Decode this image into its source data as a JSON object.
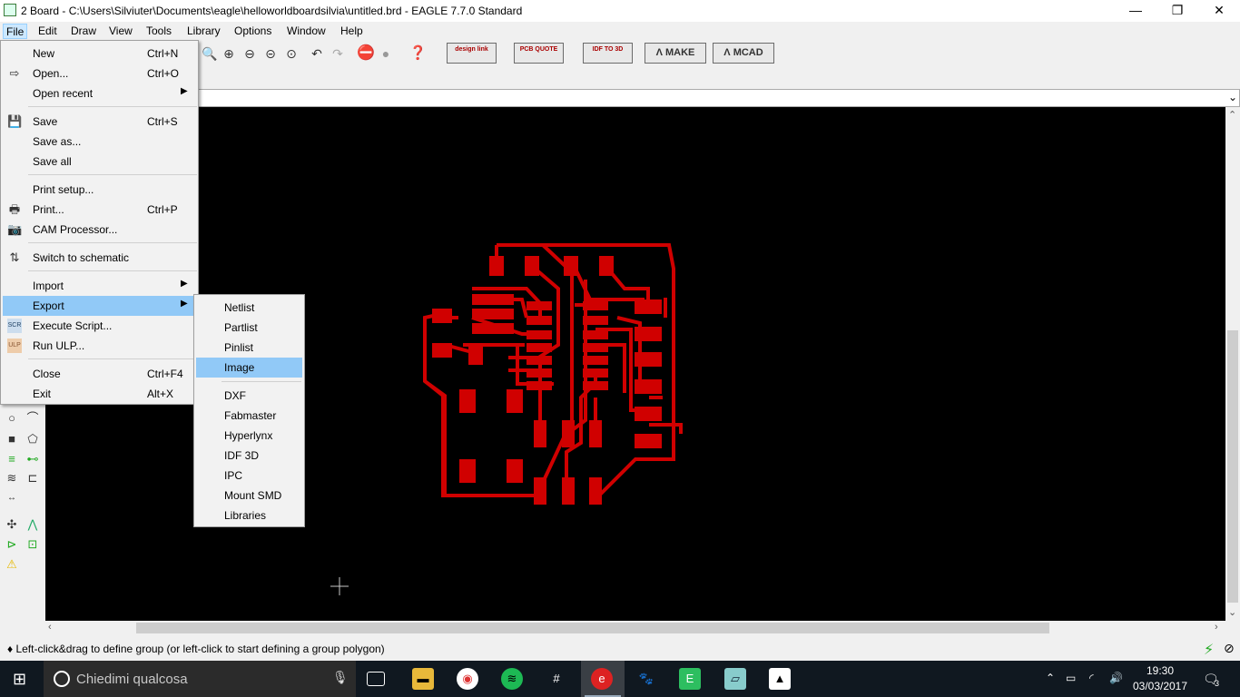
{
  "window": {
    "title": "2 Board - C:\\Users\\Silviuter\\Documents\\eagle\\helloworldboardsilvia\\untitled.brd - EAGLE 7.7.0 Standard",
    "minimize": "—",
    "maximize": "❐",
    "close": "✕"
  },
  "menubar": [
    "File",
    "Edit",
    "Draw",
    "View",
    "Tools",
    "Library",
    "Options",
    "Window",
    "Help"
  ],
  "toolbar": {
    "buttons": [
      {
        "name": "design-link",
        "label": "design link"
      },
      {
        "name": "pcb-quote",
        "label": "PCB QUOTE"
      },
      {
        "name": "idf-to-3d",
        "label": "IDF TO 3D"
      },
      {
        "name": "make",
        "label": "MAKE"
      },
      {
        "name": "mcad",
        "label": "MCAD"
      }
    ]
  },
  "file_menu": {
    "items": [
      {
        "label": "New",
        "shortcut": "Ctrl+N"
      },
      {
        "label": "Open...",
        "shortcut": "Ctrl+O"
      },
      {
        "label": "Open recent",
        "shortcut": ""
      },
      {
        "label": "Save",
        "shortcut": "Ctrl+S"
      },
      {
        "label": "Save as...",
        "shortcut": ""
      },
      {
        "label": "Save all",
        "shortcut": ""
      },
      {
        "label": "Print setup...",
        "shortcut": ""
      },
      {
        "label": "Print...",
        "shortcut": "Ctrl+P"
      },
      {
        "label": "CAM Processor...",
        "shortcut": ""
      },
      {
        "label": "Switch to schematic",
        "shortcut": ""
      },
      {
        "label": "Import",
        "shortcut": ""
      },
      {
        "label": "Export",
        "shortcut": ""
      },
      {
        "label": "Execute Script...",
        "shortcut": ""
      },
      {
        "label": "Run ULP...",
        "shortcut": ""
      },
      {
        "label": "Close",
        "shortcut": "Ctrl+F4"
      },
      {
        "label": "Exit",
        "shortcut": "Alt+X"
      }
    ]
  },
  "export_submenu": {
    "items": [
      "Netlist",
      "Partlist",
      "Pinlist",
      "Image",
      "DXF",
      "Fabmaster",
      "Hyperlynx",
      "IDF 3D",
      "IPC",
      "Mount SMD",
      "Libraries"
    ],
    "selected": "Image"
  },
  "status": {
    "message": "♦ Left-click&drag to define group (or left-click to start defining a group polygon)"
  },
  "taskbar": {
    "search_placeholder": "Chiedimi qualcosa",
    "time": "19:30",
    "date": "03/03/2017",
    "notifications": "3"
  },
  "colors": {
    "board_trace": "#d00000",
    "canvas_bg": "#000000",
    "menu_highlight": "#91c9f7"
  }
}
